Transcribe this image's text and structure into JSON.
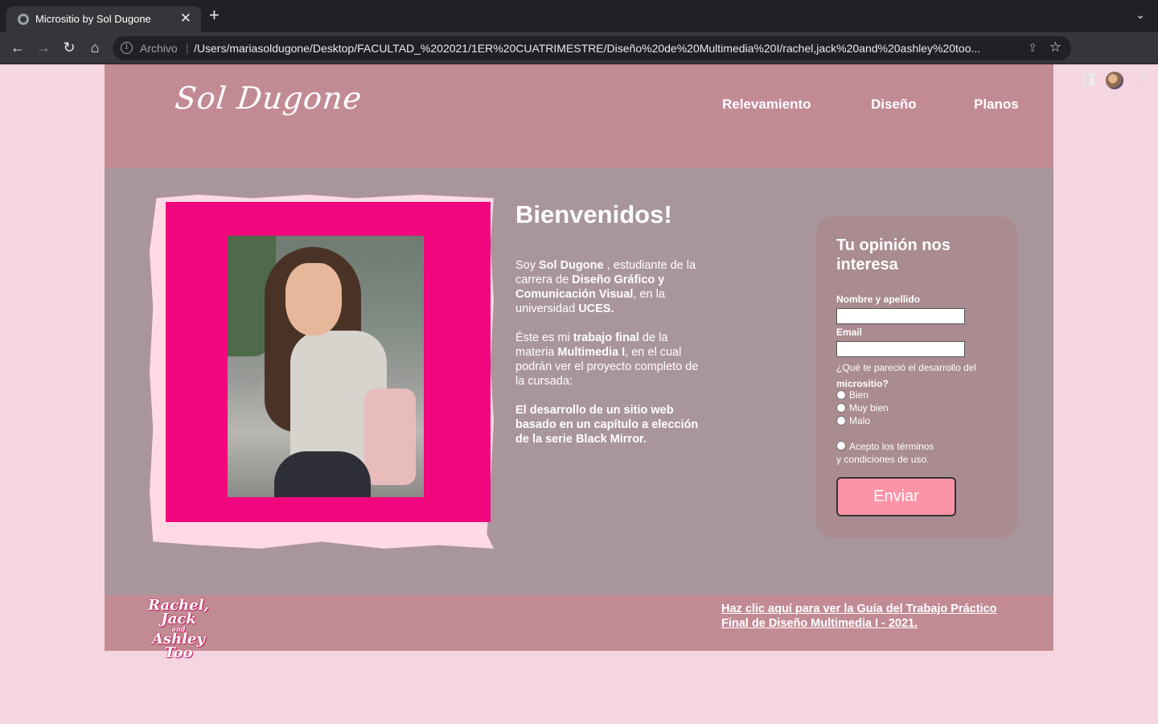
{
  "browser": {
    "tab_title": "Micrositio by Sol Dugone",
    "tab_close": "✕",
    "new_tab": "+",
    "scheme_label": "Archivo",
    "url": "/Users/mariasoldugone/Desktop/FACULTAD_%202021/1ER%20CUATRIMESTRE/Diseño%20de%20Multimedia%20I/rachel,jack%20and%20ashley%20too...",
    "icons": [
      "globe-icon",
      "back-icon",
      "forward-icon",
      "reload-icon",
      "home-icon",
      "info-icon",
      "share-icon",
      "star-icon",
      "side-panel-icon",
      "profile-avatar",
      "kebab-menu-icon"
    ]
  },
  "header": {
    "logo": "Sol Dugone",
    "nav": [
      "Relevamiento",
      "Diseño",
      "Planos"
    ]
  },
  "intro": {
    "title": "Bienvenidos!",
    "p1": {
      "t1": "Soy ",
      "b1": "Sol Dugone",
      "t2": " , estudiante de la carrera de ",
      "b2": "Diseño Gráfico y Comunicación Visual",
      "t3": ", en la universidad ",
      "b3": "UCES."
    },
    "p2": {
      "t1": "Éste es mi ",
      "b1": "trabajo final",
      "t2": " de la materia ",
      "b2": "Multimedia I",
      "t3": ", en el cual podrán ver el proyecto completo de la cursada:"
    },
    "p3": "El desarrollo de un sitio web basado en un capítulo a elección de la serie Black Mirror."
  },
  "form": {
    "title": "Tu opinión nos interesa",
    "name_label": "Nombre y apellido",
    "email_label": "Email",
    "question_text": "¿Qué te pareció el desarrollo del ",
    "question_bold": "micrositio?",
    "options": [
      "Bien",
      "Muy bien",
      "Malo"
    ],
    "terms_line1": "Acepto los términos",
    "terms_line2": "y condiciones de uso.",
    "submit": "Enviar"
  },
  "footer": {
    "logo_line1": "Rachel, Jack",
    "logo_and": "and",
    "logo_line2": "Ashley Too",
    "link": "Haz clic aquí para ver la Guía del Trabajo Práctico Final de Diseño Multimedia I - 2021."
  },
  "colors": {
    "page_bg": "#f5d5e0",
    "header_bg": "#c28b94",
    "main_bg": "#a9969c",
    "photo_frame_pink": "#f2077e",
    "form_bg": "#a98b90",
    "button_bg": "#fd93a6"
  }
}
